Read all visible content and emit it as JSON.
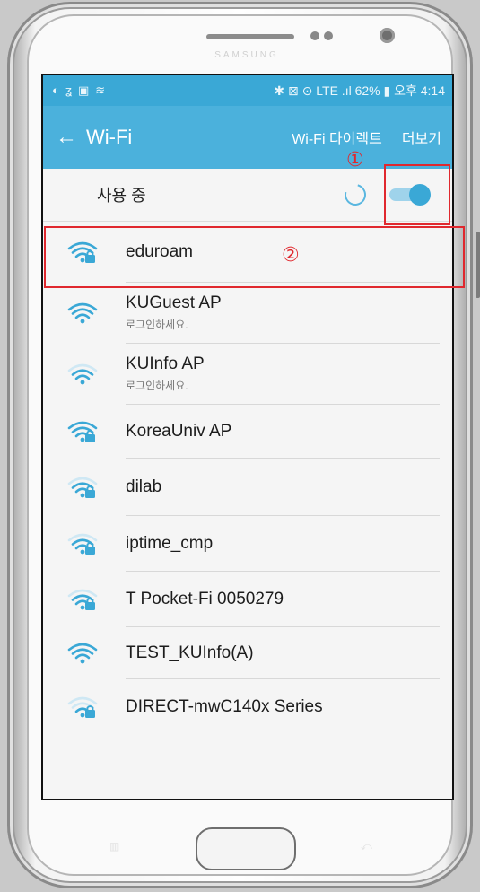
{
  "device": {
    "brand": "SAMSUNG"
  },
  "statusbar": {
    "left_icons": [
      "messenger-icon",
      "app-icon",
      "gallery-icon",
      "wifi-icon"
    ],
    "left_glyphs": [
      "◐",
      "ʓ",
      "▣",
      "≋"
    ],
    "right_text": "✱ ⊠ ⊙ LTE .ıl 62% ▮ 오후 4:14"
  },
  "appbar": {
    "back_glyph": "←",
    "title": "Wi-Fi",
    "action_direct": "Wi-Fi 다이렉트",
    "action_more": "더보기"
  },
  "master": {
    "label": "사용 중",
    "enabled": true
  },
  "annotations": {
    "one": "①",
    "two": "②"
  },
  "networks": [
    {
      "ssid": "eduroam",
      "sub": "",
      "secured": true,
      "signal": 4
    },
    {
      "ssid": "KUGuest AP",
      "sub": "로그인하세요.",
      "secured": false,
      "signal": 4
    },
    {
      "ssid": "KUInfo AP",
      "sub": "로그인하세요.",
      "secured": false,
      "signal": 3
    },
    {
      "ssid": "KoreaUniv AP",
      "sub": "",
      "secured": true,
      "signal": 4
    },
    {
      "ssid": "dilab",
      "sub": "",
      "secured": true,
      "signal": 3
    },
    {
      "ssid": "iptime_cmp",
      "sub": "",
      "secured": true,
      "signal": 3
    },
    {
      "ssid": "T Pocket-Fi 0050279",
      "sub": "",
      "secured": true,
      "signal": 3
    },
    {
      "ssid": "TEST_KUInfo(A)",
      "sub": "",
      "secured": false,
      "signal": 4
    },
    {
      "ssid": "DIRECT-mwC140x Series",
      "sub": "",
      "secured": true,
      "signal": 2
    }
  ],
  "colors": {
    "accent": "#3aa8d6",
    "appbar": "#4bb1dc",
    "annotation": "#e0282e"
  }
}
